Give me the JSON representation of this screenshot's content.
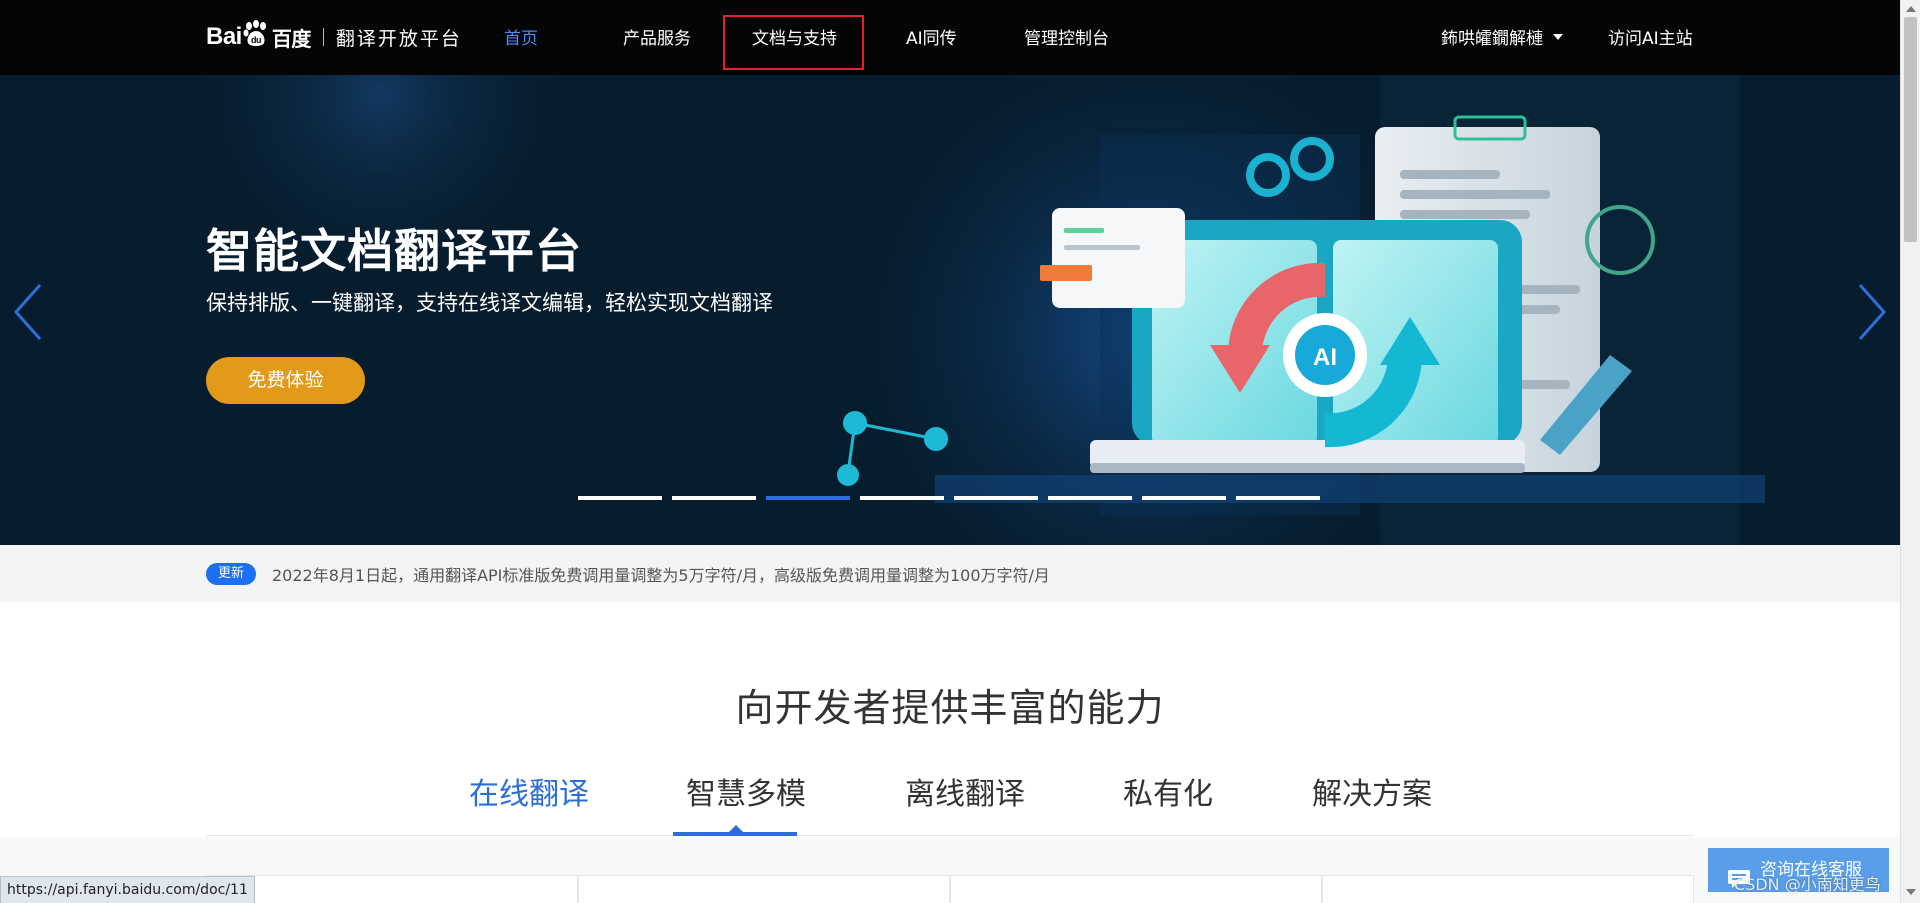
{
  "nav": {
    "logo_latin": "Bai",
    "logo_paw_text": "du",
    "logo_cn": "百度",
    "logo_sub": "翻译开放平台",
    "items": [
      {
        "label": "首页"
      },
      {
        "label": "产品服务"
      },
      {
        "label": "文档与支持"
      },
      {
        "label": "AI同传"
      },
      {
        "label": "管理控制台"
      }
    ],
    "user_label": "鈽哄皬鐗解槤",
    "visit_label": "访问AI主站"
  },
  "hero": {
    "title": "智能文档翻译平台",
    "subtitle": "保持排版、一键翻译，支持在线译文编辑，轻松实现文档翻译",
    "cta": "免费体验",
    "ai_label": "AI",
    "slide_count": 8,
    "active_slide": 3
  },
  "notice": {
    "badge": "更新",
    "text": "2022年8月1日起，通用翻译API标准版免费调用量调整为5万字符/月，高级版免费调用量调整为100万字符/月"
  },
  "section": {
    "title": "向开发者提供丰富的能力",
    "tabs": [
      {
        "label": "在线翻译"
      },
      {
        "label": "智慧多模"
      },
      {
        "label": "离线翻译"
      },
      {
        "label": "私有化"
      },
      {
        "label": "解决方案"
      }
    ]
  },
  "status_url": "https://api.fanyi.baidu.com/doc/11",
  "consult_label": "咨询在线客服",
  "watermark": "CSDN @小南知更鸟",
  "colors": {
    "nav_bg": "#050505",
    "nav_active": "#4d8cf5",
    "cta": "#e39a1a",
    "brand_blue": "#1b6ff0",
    "highlight_border": "#e8202a"
  }
}
